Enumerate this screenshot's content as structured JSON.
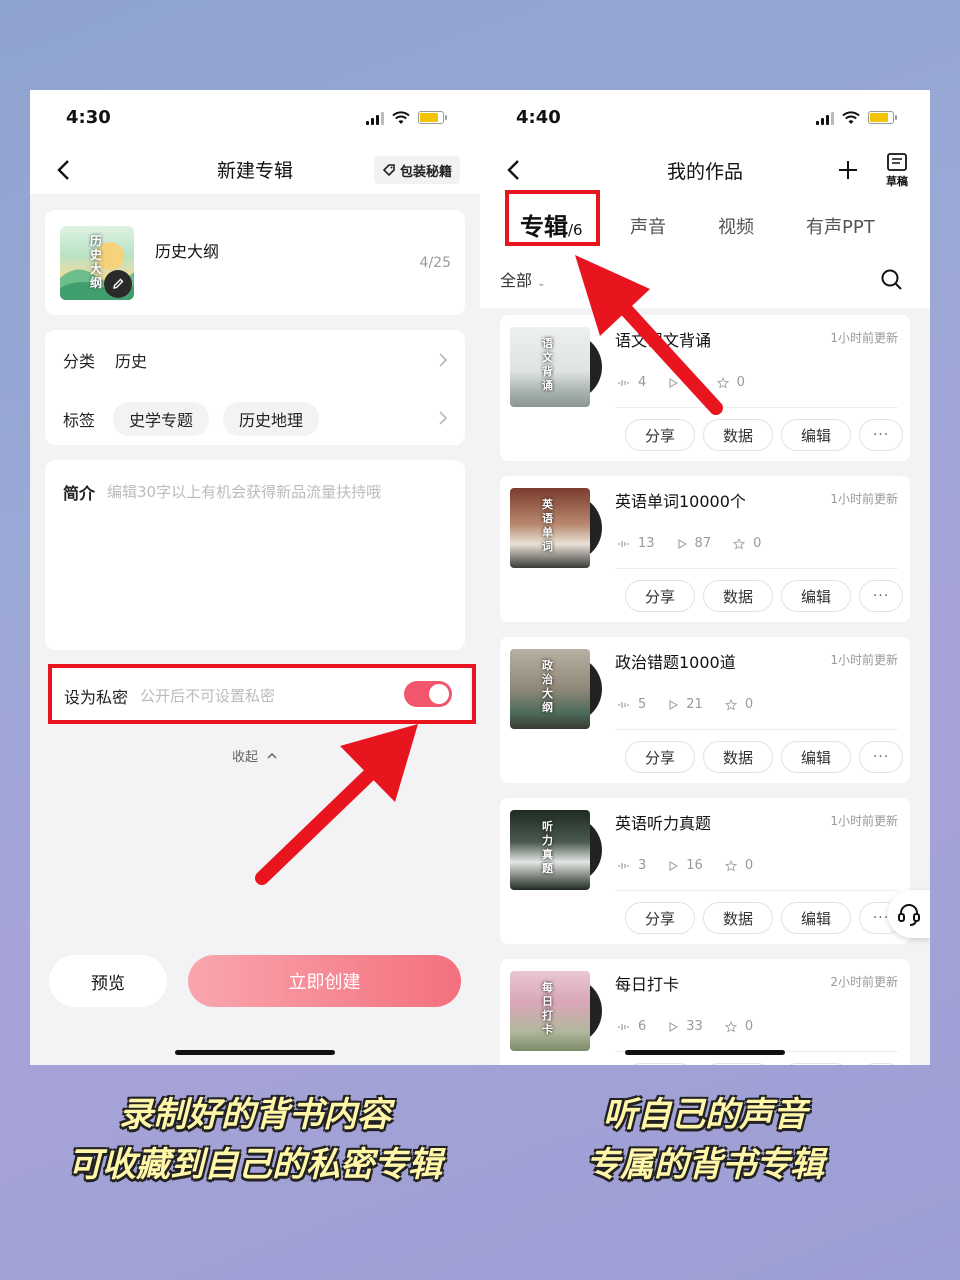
{
  "left": {
    "status_time": "4:30",
    "nav_title": "新建专辑",
    "secret_label": "包装秘籍",
    "album_name": "历史大纲",
    "cover_text": "历史大纲",
    "char_count": "4/25",
    "category_label": "分类",
    "category_value": "历史",
    "tag_label": "标签",
    "tags": [
      "史学专题",
      "历史地理"
    ],
    "intro_label": "简介",
    "intro_placeholder": "编辑30字以上有机会获得新品流量扶持哦",
    "private_label": "设为私密",
    "private_hint": "公开后不可设置私密",
    "private_on": true,
    "collapse_label": "收起",
    "preview_label": "预览",
    "create_label": "立即创建"
  },
  "right": {
    "status_time": "4:40",
    "nav_title": "我的作品",
    "draft_label": "草稿",
    "tabs": [
      {
        "label": "专辑",
        "count": "/6"
      },
      {
        "label": "声音"
      },
      {
        "label": "视频"
      },
      {
        "label": "有声PPT"
      }
    ],
    "filter_label": "全部",
    "actions": {
      "share": "分享",
      "data": "数据",
      "edit": "编辑",
      "more": "···"
    },
    "albums": [
      {
        "name": "语文课文背诵",
        "cover_text": "语文背诵",
        "updated": "1小时前更新",
        "tracks": "4",
        "plays": "2",
        "likes": "0"
      },
      {
        "name": "英语单词10000个",
        "cover_text": "英语单词",
        "updated": "1小时前更新",
        "tracks": "13",
        "plays": "87",
        "likes": "0"
      },
      {
        "name": "政治错题1000道",
        "cover_text": "政治大纲",
        "updated": "1小时前更新",
        "tracks": "5",
        "plays": "21",
        "likes": "0"
      },
      {
        "name": "英语听力真题",
        "cover_text": "听力真题",
        "updated": "1小时前更新",
        "tracks": "3",
        "plays": "16",
        "likes": "0"
      },
      {
        "name": "每日打卡",
        "cover_text": "每日打卡",
        "updated": "2小时前更新",
        "tracks": "6",
        "plays": "33",
        "likes": "0"
      }
    ]
  },
  "captions": {
    "left_line1": "录制好的背书内容",
    "left_line2": "可收藏到自己的私密专辑",
    "right_line1": "听自己的声音",
    "right_line2": "专属的背书专辑"
  },
  "colors": {
    "accent_red": "#e8141e",
    "toggle_on": "#f2566d",
    "create_gradient_end": "#f4707e"
  }
}
